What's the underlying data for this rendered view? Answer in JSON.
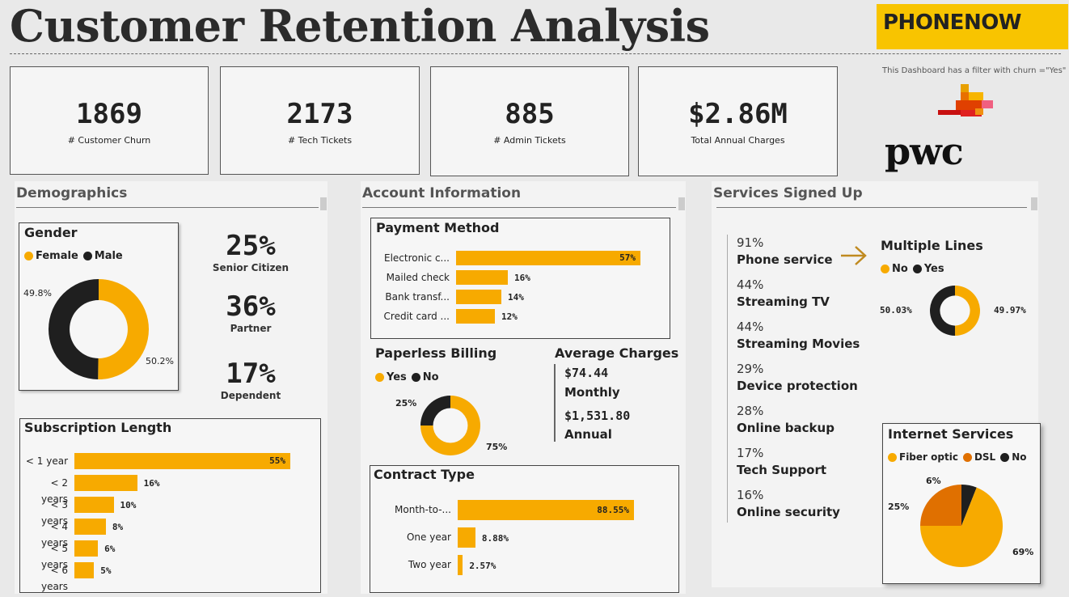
{
  "header": {
    "title": "Customer Retention Analysis",
    "brand": "PHONENOW",
    "filter_note": "This Dashboard has a filter with churn =\"Yes\"",
    "consultant_logo": "pwc"
  },
  "kpis": [
    {
      "value": "1869",
      "label": "# Customer Churn"
    },
    {
      "value": "2173",
      "label": "# Tech Tickets"
    },
    {
      "value": "885",
      "label": "# Admin Tickets"
    },
    {
      "value": "$2.86M",
      "label": "Total Annual Charges"
    }
  ],
  "colors": {
    "accent": "#f7aa00",
    "dark": "#1f1f1f",
    "orange2": "#e07000"
  },
  "demographics": {
    "title": "Demographics",
    "gender": {
      "title": "Gender",
      "legend": [
        "Female",
        "Male"
      ],
      "female_label": "50.2%",
      "male_label": "49.8%"
    },
    "stats": [
      {
        "value": "25%",
        "label": "Senior Citizen"
      },
      {
        "value": "36%",
        "label": "Partner"
      },
      {
        "value": "17%",
        "label": "Dependent"
      }
    ],
    "subscription": {
      "title": "Subscription Length",
      "rows": [
        {
          "cat": "< 1 year",
          "label": "55%"
        },
        {
          "cat": "< 2 years",
          "label": "16%"
        },
        {
          "cat": "< 3 years",
          "label": "10%"
        },
        {
          "cat": "< 4 years",
          "label": "8%"
        },
        {
          "cat": "< 5 years",
          "label": "6%"
        },
        {
          "cat": "< 6 years",
          "label": "5%"
        }
      ]
    }
  },
  "account": {
    "title": "Account Information",
    "payment": {
      "title": "Payment Method",
      "rows": [
        {
          "cat": "Electronic c...",
          "label": "57%"
        },
        {
          "cat": "Mailed check",
          "label": "16%"
        },
        {
          "cat": "Bank transf...",
          "label": "14%"
        },
        {
          "cat": "Credit card ...",
          "label": "12%"
        }
      ]
    },
    "paperless": {
      "title": "Paperless Billing",
      "legend": [
        "Yes",
        "No"
      ],
      "yes_label": "75%",
      "no_label": "25%"
    },
    "avg_charges": {
      "title": "Average Charges",
      "monthly_value": "$74.44",
      "monthly_label": "Monthly",
      "annual_value": "$1,531.80",
      "annual_label": "Annual"
    },
    "contract": {
      "title": "Contract Type",
      "rows": [
        {
          "cat": "Month-to-...",
          "label": "88.55%"
        },
        {
          "cat": "One year",
          "label": "8.88%"
        },
        {
          "cat": "Two year",
          "label": "2.57%"
        }
      ]
    }
  },
  "services": {
    "title": "Services Signed Up",
    "list": [
      {
        "pct": "91%",
        "name": "Phone service"
      },
      {
        "pct": "44%",
        "name": "Streaming TV"
      },
      {
        "pct": "44%",
        "name": "Streaming Movies"
      },
      {
        "pct": "29%",
        "name": "Device protection"
      },
      {
        "pct": "28%",
        "name": "Online backup"
      },
      {
        "pct": "17%",
        "name": "Tech Support"
      },
      {
        "pct": "16%",
        "name": "Online security"
      }
    ],
    "multiple_lines": {
      "title": "Multiple Lines",
      "legend": [
        "No",
        "Yes"
      ],
      "no_label": "49.97%",
      "yes_label": "50.03%"
    },
    "internet": {
      "title": "Internet Services",
      "legend": [
        "Fiber optic",
        "DSL",
        "No"
      ],
      "fiber_label": "69%",
      "dsl_label": "25%",
      "no_label": "6%"
    }
  },
  "chart_data": [
    {
      "type": "pie",
      "title": "Gender",
      "categories": [
        "Female",
        "Male"
      ],
      "values": [
        50.2,
        49.8
      ]
    },
    {
      "type": "bar",
      "title": "Subscription Length",
      "categories": [
        "< 1 year",
        "< 2 years",
        "< 3 years",
        "< 4 years",
        "< 5 years",
        "< 6 years"
      ],
      "values": [
        55,
        16,
        10,
        8,
        6,
        5
      ]
    },
    {
      "type": "bar",
      "title": "Payment Method",
      "categories": [
        "Electronic c...",
        "Mailed check",
        "Bank transf...",
        "Credit card ..."
      ],
      "values": [
        57,
        16,
        14,
        12
      ]
    },
    {
      "type": "pie",
      "title": "Paperless Billing",
      "categories": [
        "Yes",
        "No"
      ],
      "values": [
        75,
        25
      ]
    },
    {
      "type": "bar",
      "title": "Contract Type",
      "categories": [
        "Month-to-...",
        "One year",
        "Two year"
      ],
      "values": [
        88.55,
        8.88,
        2.57
      ]
    },
    {
      "type": "pie",
      "title": "Multiple Lines",
      "categories": [
        "No",
        "Yes"
      ],
      "values": [
        49.97,
        50.03
      ]
    },
    {
      "type": "pie",
      "title": "Internet Services",
      "categories": [
        "Fiber optic",
        "DSL",
        "No"
      ],
      "values": [
        69,
        25,
        6
      ]
    }
  ]
}
